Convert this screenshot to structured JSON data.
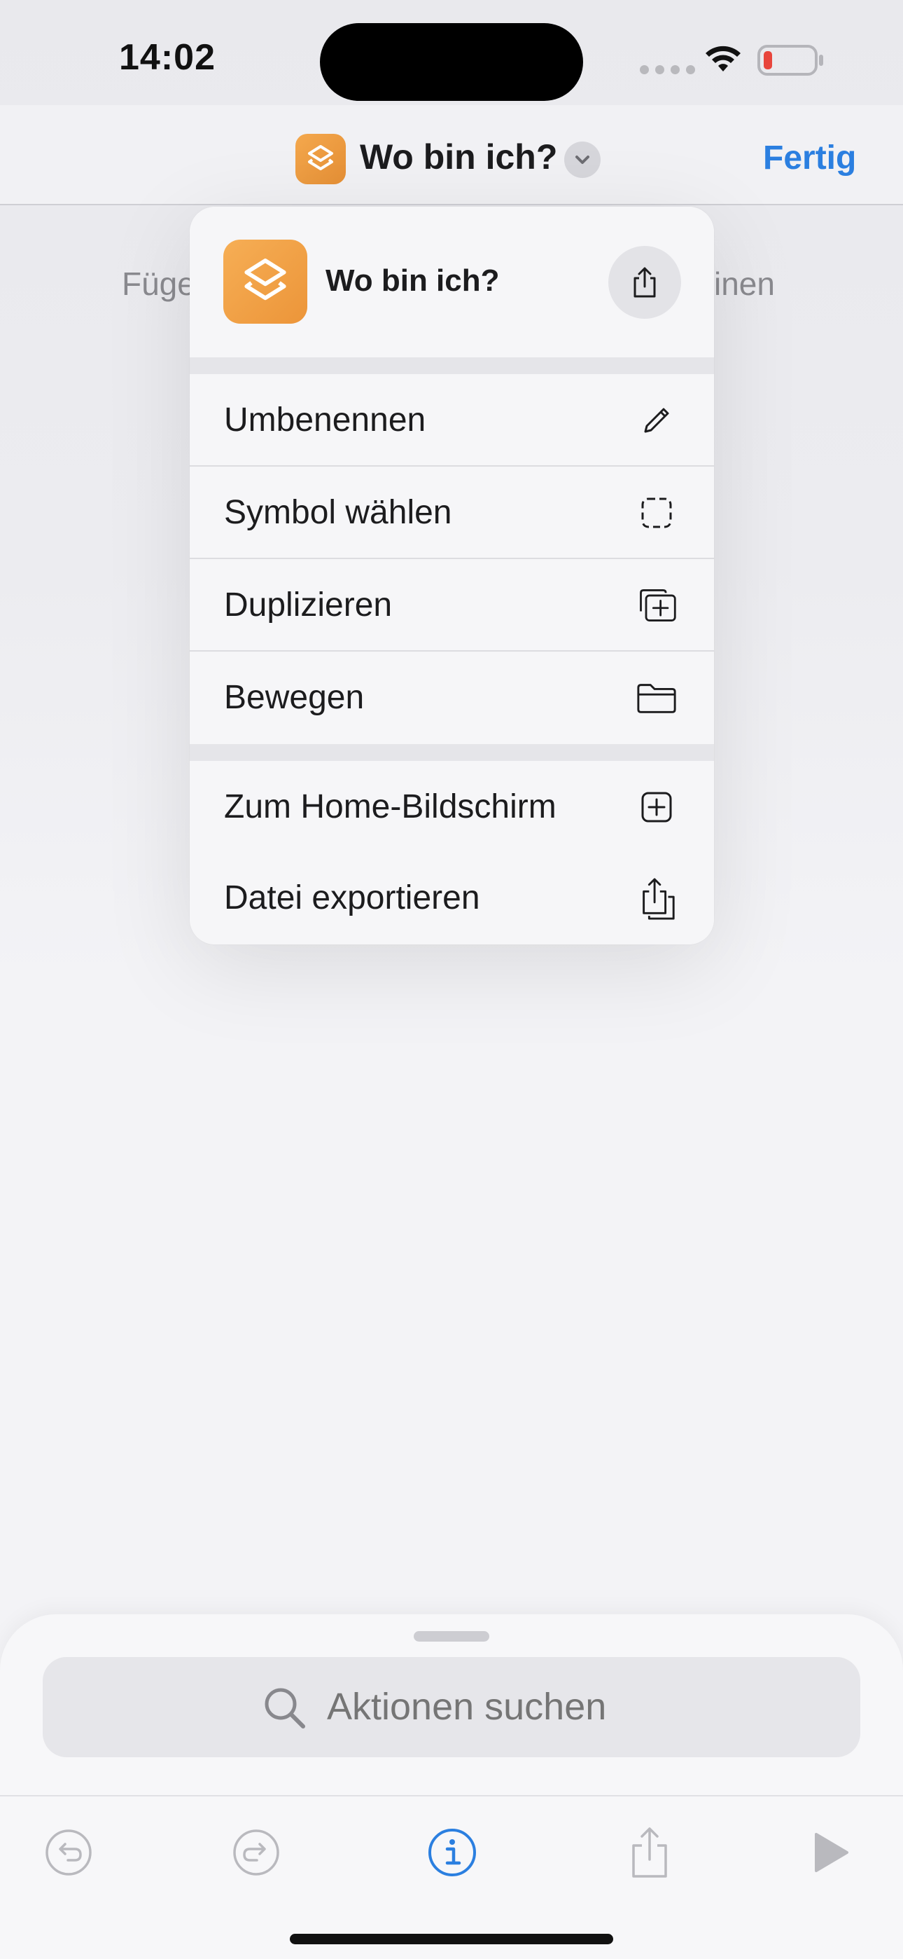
{
  "status_bar": {
    "time": "14:02"
  },
  "nav": {
    "title": "Wo bin ich?",
    "done_label": "Fertig"
  },
  "background_hint": {
    "left_fragment": "Füge",
    "right_fragment": "inen"
  },
  "menu": {
    "app_name": "Wo bin ich?",
    "sections": [
      {
        "items": [
          {
            "label": "Umbenennen",
            "icon": "pencil-icon"
          },
          {
            "label": "Symbol wählen",
            "icon": "dashed-square-icon"
          },
          {
            "label": "Duplizieren",
            "icon": "duplicate-icon"
          },
          {
            "label": "Bewegen",
            "icon": "folder-icon"
          }
        ]
      },
      {
        "items": [
          {
            "label": "Zum Home-Bildschirm",
            "icon": "plus-square-icon"
          },
          {
            "label": "Datei exportieren",
            "icon": "export-file-icon"
          }
        ]
      }
    ]
  },
  "search": {
    "placeholder": "Aktionen suchen"
  },
  "toolbar": {
    "items": [
      "undo-icon",
      "redo-icon",
      "info-icon",
      "share-icon",
      "play-icon"
    ]
  },
  "colors": {
    "accent": "#2b7fe0",
    "app_icon": "#f0a045",
    "battery_low": "#e8453c"
  }
}
